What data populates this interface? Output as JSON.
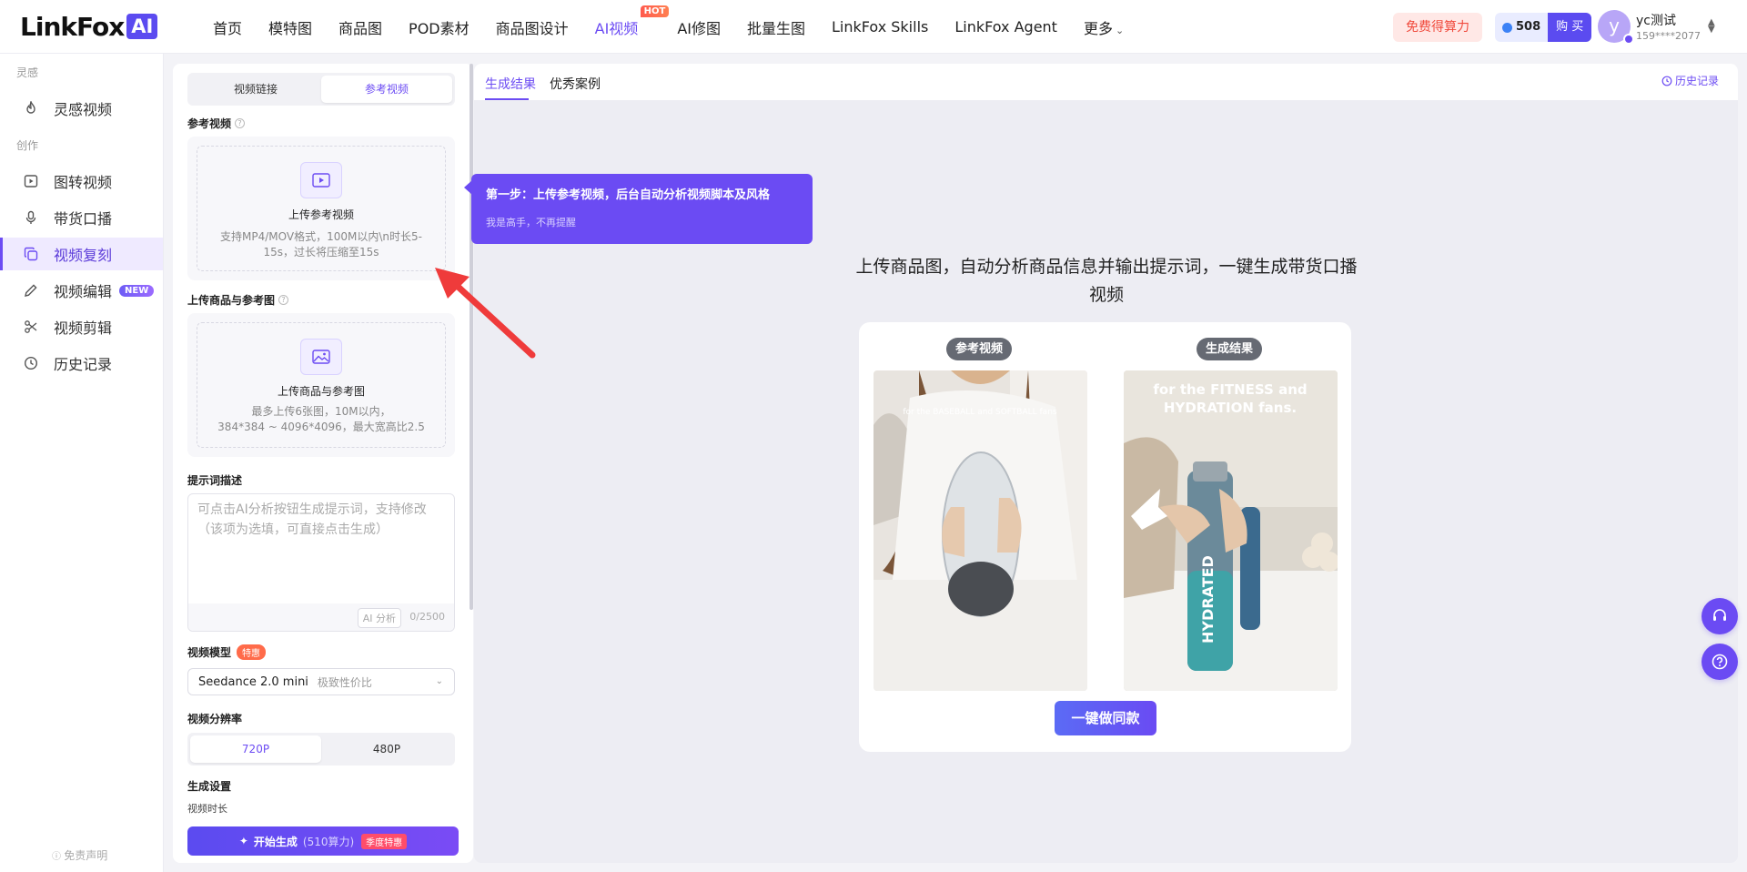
{
  "header": {
    "logo_text": "LinkFox",
    "logo_badge": "AI",
    "nav": [
      {
        "label": "首页"
      },
      {
        "label": "模特图"
      },
      {
        "label": "商品图"
      },
      {
        "label": "POD素材"
      },
      {
        "label": "商品图设计"
      },
      {
        "label": "AI视频",
        "badge": "HOT",
        "active": true
      },
      {
        "label": "AI修图"
      },
      {
        "label": "批量生图"
      },
      {
        "label": "LinkFox Skills"
      },
      {
        "label": "LinkFox Agent"
      },
      {
        "label": "更多"
      }
    ],
    "free_label": "免费得算力",
    "credits": "508",
    "buy_label": "购 买",
    "user": {
      "avatar": "y",
      "name": "yc测试",
      "phone": "159****2077"
    }
  },
  "sidebar": {
    "group_inspiration": "灵感",
    "group_create": "创作",
    "items": [
      {
        "label": "灵感视频",
        "icon": "flame-icon"
      },
      {
        "label": "图转视频",
        "icon": "play-square-icon"
      },
      {
        "label": "带货口播",
        "icon": "microphone-icon"
      },
      {
        "label": "视频复刻",
        "icon": "copy-icon",
        "active": true
      },
      {
        "label": "视频编辑",
        "icon": "pencil-icon",
        "badge": "NEW"
      },
      {
        "label": "视频剪辑",
        "icon": "scissors-icon"
      },
      {
        "label": "历史记录",
        "icon": "clock-icon"
      }
    ],
    "disclaimer": "免责声明"
  },
  "form": {
    "mode_tabs": [
      "视频链接",
      "参考视频"
    ],
    "ref_video_label": "参考视频",
    "ref_upload_title": "上传参考视频",
    "ref_upload_desc": "支持MP4/MOV格式，100M以内\\n时长5-15s，过长将压缩至15s",
    "product_label": "上传商品与参考图",
    "product_upload_title": "上传商品与参考图",
    "product_upload_desc1": "最多上传6张图，10M以内，",
    "product_upload_desc2": "384*384 ~ 4096*4096，最大宽高比2.5",
    "prompt_label": "提示词描述",
    "prompt_placeholder": "可点击AI分析按钮生成提示词，支持修改（该项为选填，可直接点击生成）",
    "ai_analyze": "AI 分析",
    "char_count": "0/2500",
    "model_label": "视频模型",
    "model_tag": "特惠",
    "model_value": "Seedance 2.0 mini",
    "model_sub": "极致性价比",
    "resolution_label": "视频分辨率",
    "resolutions": [
      "720P",
      "480P"
    ],
    "settings_label": "生成设置",
    "duration_label": "视频时长",
    "generate_label": "开始生成",
    "generate_cost": "(510算力)",
    "generate_promo": "季度特惠"
  },
  "main": {
    "tabs": [
      "生成结果",
      "优秀案例"
    ],
    "history_link": "历史记录",
    "headline": "上传商品图，自动分析商品信息并输出提示词，一键生成带货口播视频",
    "ref_pill": "参考视频",
    "result_pill": "生成结果",
    "ref_overlay": "for the BASEBALL and SOFTBALL fans",
    "result_overlay_1": "for the FITNESS and",
    "result_overlay_2": "HYDRATION fans.",
    "bottle_text": "HYDRATED",
    "make_same": "一键做同款"
  },
  "tooltip": {
    "title": "第一步：上传参考视频，后台自动分析视频脚本及风格",
    "dismiss": "我是高手，不再提醒"
  },
  "colors": {
    "accent": "#6c4cf3",
    "hot": "#ff5a4e",
    "arrow": "#ef3b3b"
  }
}
